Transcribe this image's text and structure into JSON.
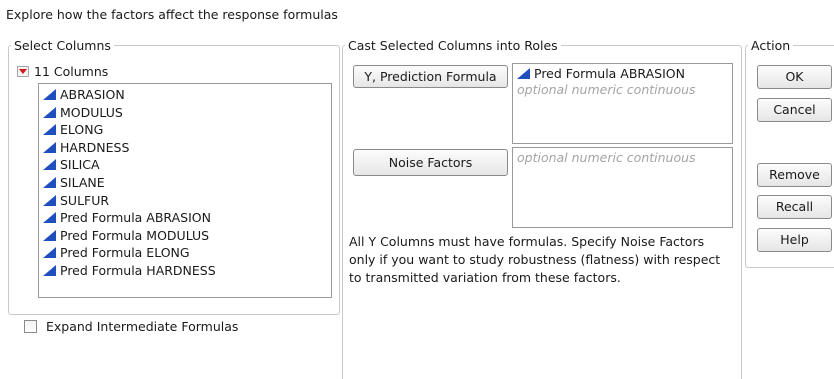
{
  "header": "Explore how the factors affect the response formulas",
  "select_columns": {
    "legend": "Select Columns",
    "count_label": "11 Columns",
    "columns": [
      "ABRASION",
      "MODULUS",
      "ELONG",
      "HARDNESS",
      "SILICA",
      "SILANE",
      "SULFUR",
      "Pred Formula ABRASION",
      "Pred Formula MODULUS",
      "Pred Formula ELONG",
      "Pred Formula HARDNESS"
    ]
  },
  "cast": {
    "legend": "Cast Selected Columns into Roles",
    "y_button": "Y, Prediction Formula",
    "y_items": [
      "Pred Formula ABRASION"
    ],
    "y_hint": "optional numeric continuous",
    "noise_button": "Noise Factors",
    "noise_hint": "optional numeric continuous",
    "note": "All Y Columns must have formulas.  Specify Noise Factors only if you want to study robustness (flatness) with respect to transmitted variation from these factors."
  },
  "action": {
    "legend": "Action",
    "ok": "OK",
    "cancel": "Cancel",
    "remove": "Remove",
    "recall": "Recall",
    "help": "Help"
  },
  "expand_checkbox": {
    "label": "Expand Intermediate Formulas",
    "checked": false
  },
  "colors": {
    "continuous_icon": "#1f4fbf",
    "menu_triangle": "#d01818",
    "hint_text": "#a4a4a4"
  }
}
